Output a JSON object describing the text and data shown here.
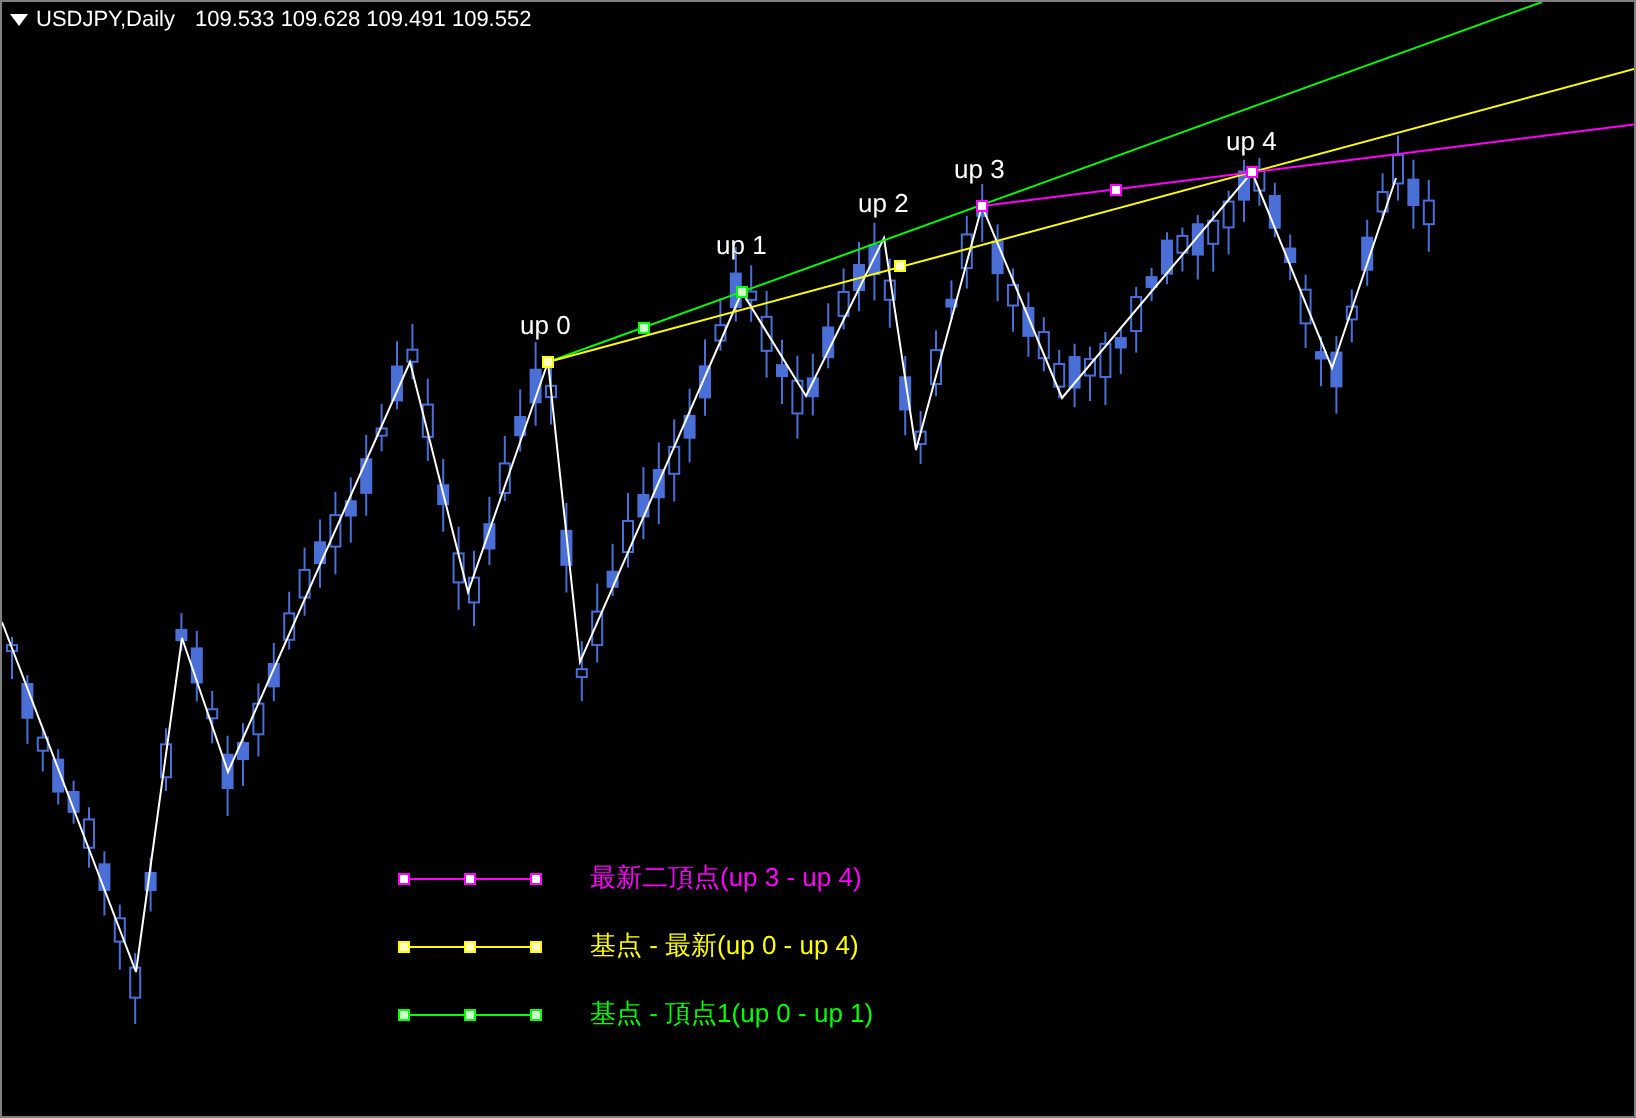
{
  "header": {
    "symbol": "USDJPY,Daily",
    "prices": "109.533 109.628 109.491 109.552"
  },
  "peaks": [
    {
      "label": "up 0"
    },
    {
      "label": "up 1"
    },
    {
      "label": "up 2"
    },
    {
      "label": "up 3"
    },
    {
      "label": "up 4"
    }
  ],
  "legend": [
    {
      "text": "最新二頂点(up 3 - up 4)",
      "color": "#ff00ff"
    },
    {
      "text": "基点 - 最新(up 0 - up 4)",
      "color": "#ffff00"
    },
    {
      "text": "基点 - 頂点1(up 0 - up 1)",
      "color": "#00ff00"
    }
  ]
}
